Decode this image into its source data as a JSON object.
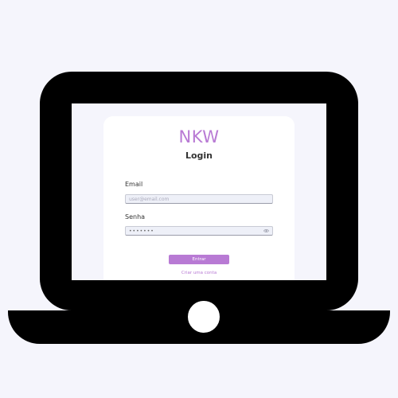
{
  "brand": "NKW",
  "login": {
    "title": "Login",
    "email": {
      "label": "Email",
      "placeholder": "user@email.com",
      "value": ""
    },
    "password": {
      "label": "Senha",
      "value": "•••••••",
      "toggle_icon": "eye-icon"
    },
    "submit_label": "Entrar",
    "create_account_label": "Criar uma conta"
  },
  "colors": {
    "accent": "#b87ad4",
    "background": "#f5f5fc",
    "device": "#000000",
    "card": "#ffffff"
  }
}
